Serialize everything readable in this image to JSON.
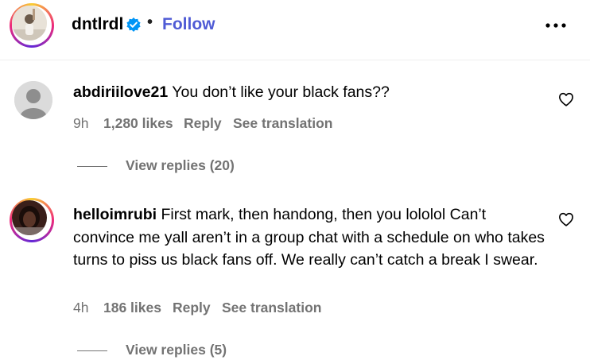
{
  "header": {
    "username": "dntlrdl",
    "separator": "•",
    "follow_label": "Follow",
    "more_icon": "more-horizontal-icon",
    "verified_icon": "verified-badge-icon"
  },
  "comments": [
    {
      "author": "abdiriilove21",
      "text": "You don’t like your black fans??",
      "time": "9h",
      "likes": "1,280 likes",
      "reply_label": "Reply",
      "translate_label": "See translation",
      "view_replies": "View replies (20)"
    },
    {
      "author": "helloimrubi",
      "text": "First mark, then handong, then you lololol Can’t convince me yall aren’t in a group chat with a schedule on who takes turns to piss us black fans off. We really can’t catch a break I swear.",
      "time": "4h",
      "likes": "186 likes",
      "reply_label": "Reply",
      "translate_label": "See translation",
      "view_replies": "View replies (5)"
    }
  ],
  "colors": {
    "accent": "#4f5bd5",
    "secondary_text": "#737373",
    "verified_blue": "#0095f6"
  }
}
